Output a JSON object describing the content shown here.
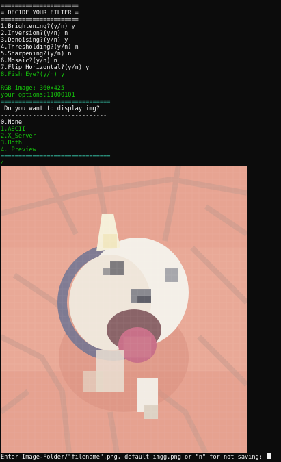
{
  "header": {
    "rule_top": "======================",
    "title": "= DECIDE YOUR FILTER =",
    "rule_bottom": "======================"
  },
  "filters": [
    {
      "label": "1.Brightening?(y/n) y"
    },
    {
      "label": "2.Inversion?(y/n) n"
    },
    {
      "label": "3.Denoising?(y/n) y"
    },
    {
      "label": "4.Thresholding?(y/n) n"
    },
    {
      "label": "5.Sharpening?(y/n) n"
    },
    {
      "label": "6.Mosaic?(y/n) n"
    },
    {
      "label": "7.Flip Horizontal?(y/n) y"
    },
    {
      "label": "8.Fish Eye?(y/n) y"
    }
  ],
  "info": {
    "image_info": "RGB image: 360x425",
    "options": "your options:11000101",
    "rule": "==============================="
  },
  "display_menu": {
    "question": " Do you want to display img?",
    "rule": "------------------------------",
    "items": [
      {
        "label": "0.None"
      },
      {
        "label": "1.ASCII"
      },
      {
        "label": "2.X_Server"
      },
      {
        "label": "3.Both"
      },
      {
        "label": "4. Preview"
      }
    ],
    "rule_bottom": "==============================="
  },
  "user_choice": "4",
  "preview_image": {
    "description_colors": {
      "background": "#e8a694",
      "grout": "#c9907f",
      "fur": "#f4eee6",
      "collar": "#6a6f88",
      "tongue": "#c86e86"
    }
  },
  "prompt": {
    "text": "Enter Image-Folder/\"filename\".png, default imgg.png or \"n\" for not saving: "
  }
}
